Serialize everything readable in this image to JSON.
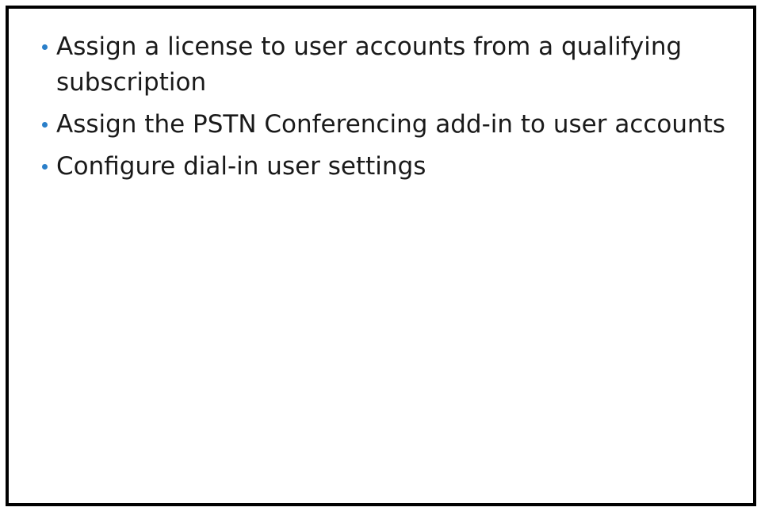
{
  "colors": {
    "bullet": "#2a7fc9",
    "text": "#1a1a1a",
    "frame": "#000000"
  },
  "bullets": [
    {
      "text": "Assign a license to user accounts from a qualifying subscription"
    },
    {
      "text": "Assign the PSTN Conferencing add-in to user accounts"
    },
    {
      "text": "Configure dial-in user settings"
    }
  ]
}
